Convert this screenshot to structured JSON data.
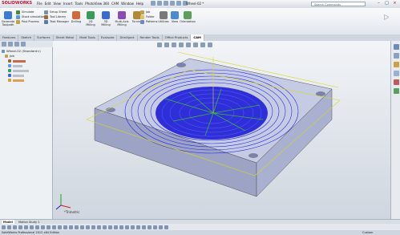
{
  "app": {
    "brand": "SOLIDWORKS",
    "window_title": "Wheel-02 *",
    "search_placeholder": "Search Commands"
  },
  "menu": [
    "File",
    "Edit",
    "View",
    "Insert",
    "Tools",
    "PhotoView 360",
    "CAM",
    "Window",
    "Help"
  ],
  "ribbon": {
    "left_buttons": [
      {
        "label": "Generate Toolpath",
        "icon": "generate-toolpath-icon"
      }
    ],
    "small_buttons": [
      {
        "label": "Simulate",
        "icon": "simulate-icon"
      },
      {
        "label": "Stock simulation",
        "icon": "stock-simulation-icon"
      },
      {
        "label": "Post Process",
        "icon": "post-process-icon"
      },
      {
        "label": "Setup Sheet",
        "icon": "setup-sheet-icon"
      },
      {
        "label": "Tool Library",
        "icon": "tool-library-icon"
      },
      {
        "label": "Task Manager",
        "icon": "task-manager-icon"
      }
    ],
    "big_buttons": [
      {
        "label": "Drilling",
        "icon": "drilling-icon"
      },
      {
        "label": "2D Milling",
        "icon": "2d-milling-icon"
      },
      {
        "label": "3D Milling",
        "icon": "3d-milling-icon"
      },
      {
        "label": "Multi-Axis Milling",
        "icon": "multi-axis-icon"
      },
      {
        "label": "Turning",
        "icon": "turning-icon"
      }
    ],
    "right_small": [
      {
        "label": "Job",
        "icon": "job-icon"
      },
      {
        "label": "Folder",
        "icon": "folder-icon"
      },
      {
        "label": "Patterns",
        "icon": "patterns-icon"
      }
    ],
    "utility_buttons": [
      {
        "label": "Utilities",
        "icon": "utilities-icon"
      },
      {
        "label": "View",
        "icon": "view-icon"
      },
      {
        "label": "Orientation",
        "icon": "orientation-icon"
      }
    ]
  },
  "tabs": [
    "Features",
    "Sketch",
    "Surfaces",
    "Sheet Metal",
    "Mold Tools",
    "Evaluate",
    "DimXpert",
    "Render Tools",
    "Office Products",
    "CAM"
  ],
  "active_tab": "CAM",
  "tree": {
    "root": "Wheel-02 (Standard<)",
    "items": [
      {
        "label": "Job",
        "indent": 1
      },
      {
        "label": "",
        "indent": 2
      },
      {
        "label": "",
        "indent": 2
      },
      {
        "label": "",
        "indent": 2
      },
      {
        "label": "",
        "indent": 2
      },
      {
        "label": "",
        "indent": 2
      }
    ]
  },
  "viewport": {
    "view_label": "*Trimetric"
  },
  "bottom_tabs": [
    "Model",
    "Motion Study 1"
  ],
  "active_bottom_tab": "Model",
  "status": {
    "left": "SolidWorks Professional 2012 x64 Edition",
    "right": "Custom"
  },
  "colors": {
    "accent": "#c8102e",
    "toolpath": "#1a1ae6",
    "part": "#b8bfdd"
  }
}
